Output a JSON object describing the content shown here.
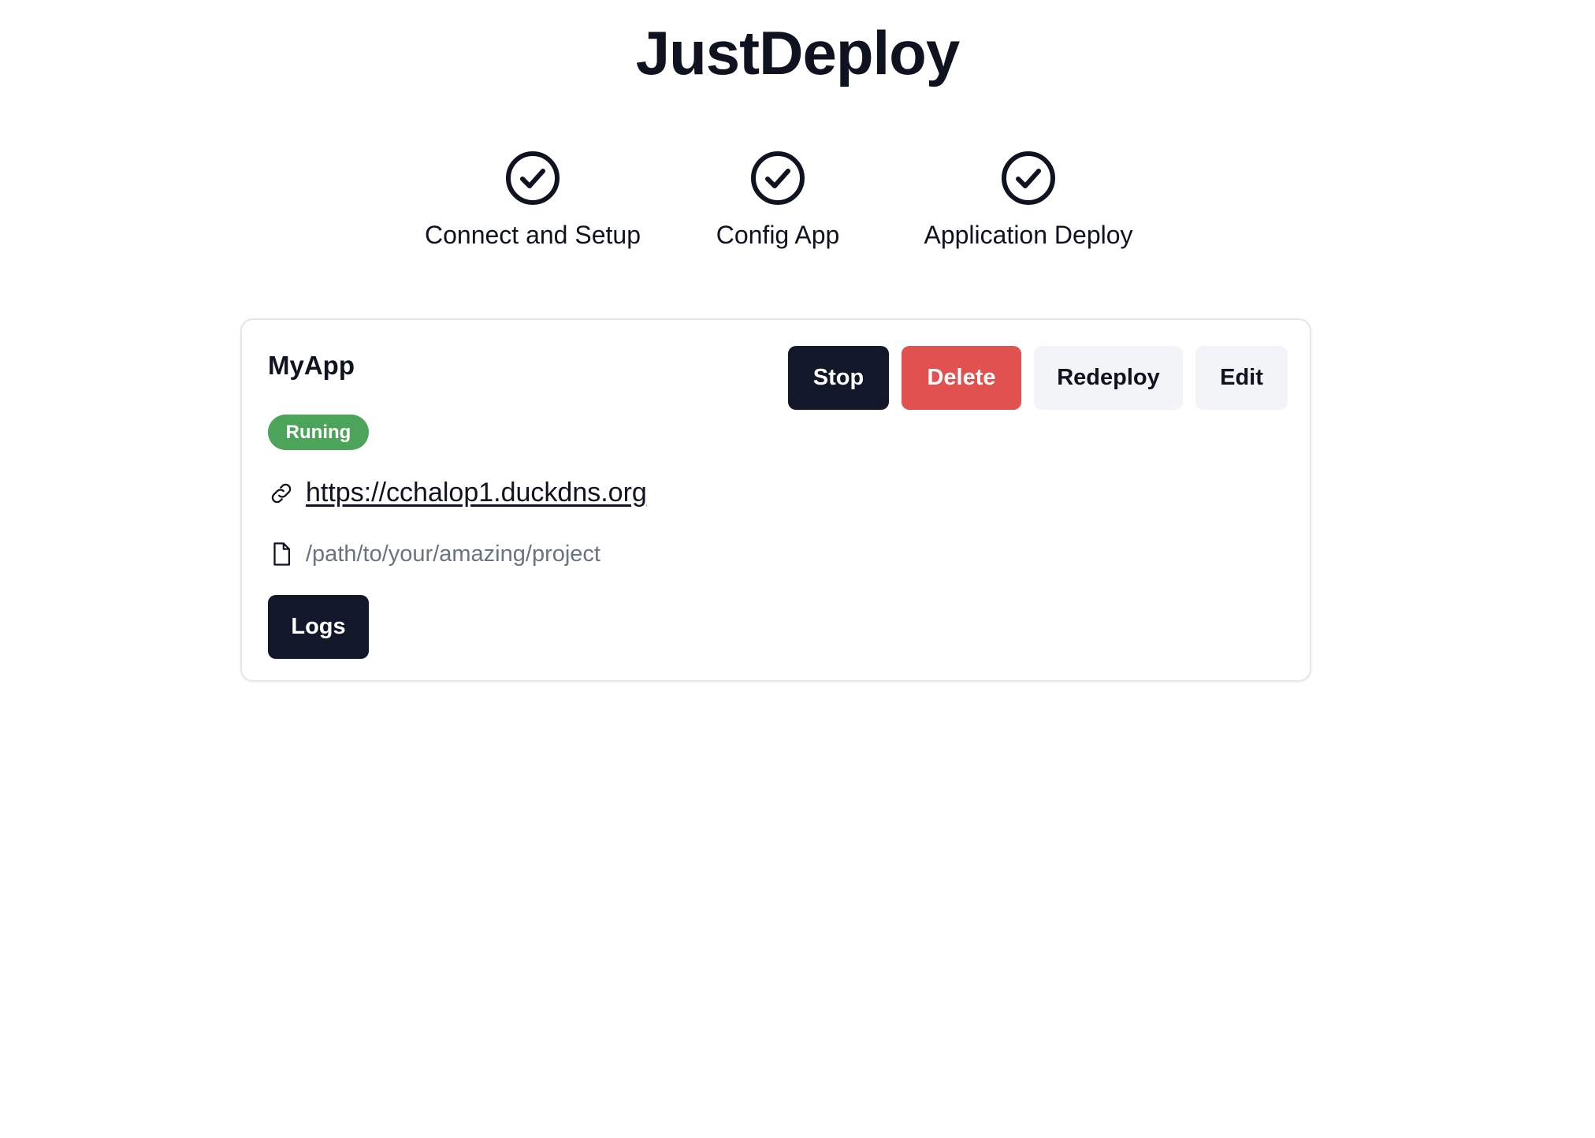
{
  "header": {
    "title": "JustDeploy"
  },
  "steps": [
    {
      "label": "Connect and Setup",
      "icon": "check-circle-icon"
    },
    {
      "label": "Config App",
      "icon": "check-circle-icon"
    },
    {
      "label": "Application Deploy",
      "icon": "check-circle-icon"
    }
  ],
  "app_card": {
    "name": "MyApp",
    "status": "Runing",
    "url": "https://cchalop1.duckdns.org",
    "path": "/path/to/your/amazing/project",
    "actions": {
      "stop": "Stop",
      "delete": "Delete",
      "redeploy": "Redeploy",
      "edit": "Edit"
    },
    "logs_label": "Logs",
    "url_icon": "link-icon",
    "path_icon": "file-icon"
  },
  "colors": {
    "primary_dark": "#121829",
    "danger": "#e05150",
    "secondary": "#f2f4f7",
    "status_running": "#4ca45a",
    "muted_text": "#6b7280"
  }
}
